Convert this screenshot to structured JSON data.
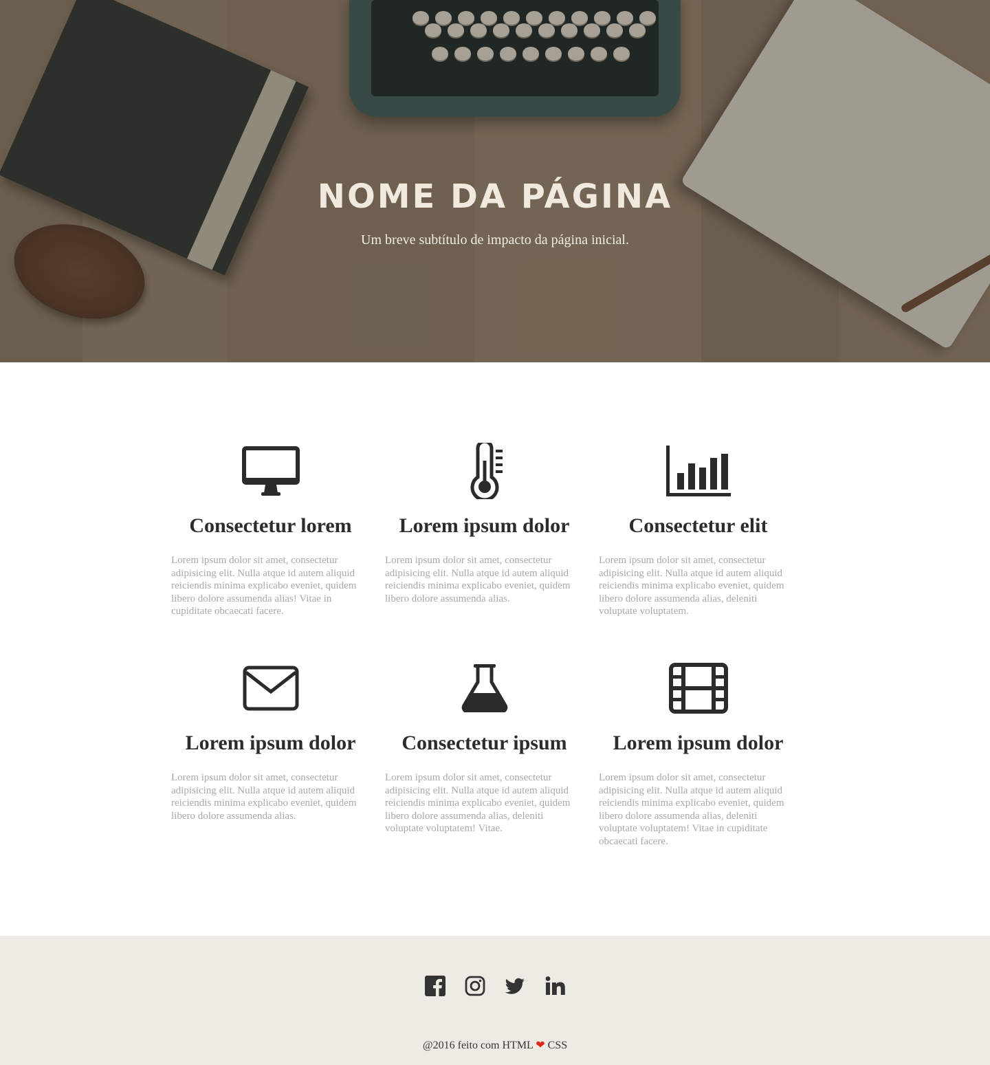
{
  "hero": {
    "title": "NOME DA PÁGINA",
    "subtitle": "Um breve subtítulo de impacto da página inicial."
  },
  "features": [
    {
      "icon": "desktop-icon",
      "title": "Consectetur lorem",
      "text": "Lorem ipsum dolor sit amet, consectetur adipisicing elit. Nulla atque id autem aliquid reiciendis minima explicabo eveniet, quidem libero dolore assumenda alias! Vitae in cupiditate obcaecati facere."
    },
    {
      "icon": "thermometer-icon",
      "title": "Lorem ipsum dolor",
      "text": "Lorem ipsum dolor sit amet, consectetur adipisicing elit. Nulla atque id autem aliquid reiciendis minima explicabo eveniet, quidem libero dolore assumenda alias."
    },
    {
      "icon": "bar-chart-icon",
      "title": "Consectetur elit",
      "text": "Lorem ipsum dolor sit amet, consectetur adipisicing elit. Nulla atque id autem aliquid reiciendis minima explicabo eveniet, quidem libero dolore assumenda alias, deleniti voluptate voluptatem."
    },
    {
      "icon": "envelope-icon",
      "title": "Lorem ipsum dolor",
      "text": "Lorem ipsum dolor sit amet, consectetur adipisicing elit. Nulla atque id autem aliquid reiciendis minima explicabo eveniet, quidem libero dolore assumenda alias."
    },
    {
      "icon": "flask-icon",
      "title": "Consectetur ipsum",
      "text": "Lorem ipsum dolor sit amet, consectetur adipisicing elit. Nulla atque id autem aliquid reiciendis minima explicabo eveniet, quidem libero dolore assumenda alias, deleniti voluptate voluptatem! Vitae."
    },
    {
      "icon": "film-icon",
      "title": "Lorem ipsum dolor",
      "text": "Lorem ipsum dolor sit amet, consectetur adipisicing elit. Nulla atque id autem aliquid reiciendis minima explicabo eveniet, quidem libero dolore assumenda alias, deleniti voluptate voluptatem! Vitae in cupiditate obcaecati facere."
    }
  ],
  "footer": {
    "social": [
      "facebook-icon",
      "instagram-icon",
      "twitter-icon",
      "linkedin-icon"
    ],
    "copyright_prefix": "@2016 feito com HTML",
    "heart": "❤",
    "copyright_suffix": "CSS"
  },
  "colors": {
    "icon": "#2b2b2b",
    "body_text": "#a9a9a9",
    "footer_bg": "#edebe4",
    "heart": "#e2231a"
  }
}
